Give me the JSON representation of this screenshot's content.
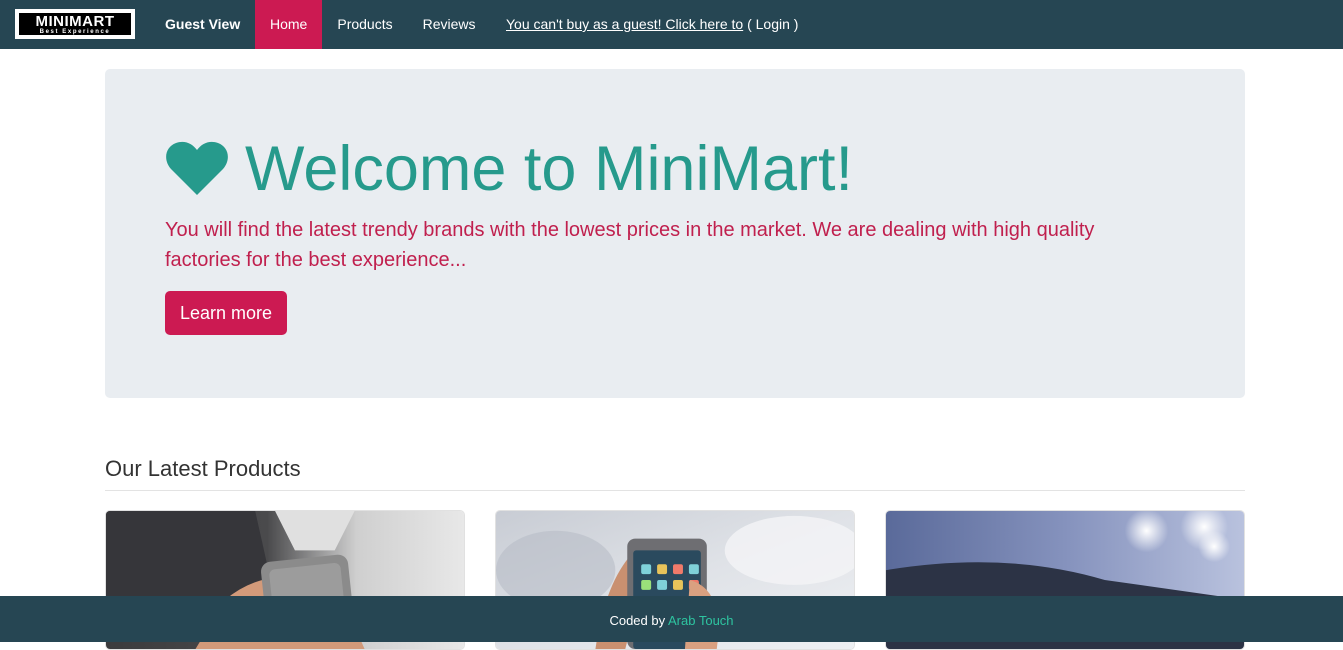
{
  "navbar": {
    "brand": {
      "main": "MINIMART",
      "sub": "Best Experience"
    },
    "guest_label": "Guest View",
    "links": [
      {
        "label": "Home",
        "active": true
      },
      {
        "label": "Products",
        "active": false
      },
      {
        "label": "Reviews",
        "active": false
      }
    ],
    "login_note": {
      "underlined": "You can't buy as a guest! Click here to",
      "rest": " ( Login )"
    },
    "bg_color": "#264653",
    "active_color": "#cc1a52"
  },
  "hero": {
    "icon": "heart-icon",
    "title": "Welcome to MiniMart!",
    "text": "You will find the latest trendy brands with the lowest prices in the market. We are dealing with high quality factories for the best experience...",
    "button_label": "Learn more",
    "title_color": "#269a8c",
    "text_color": "#c0204e"
  },
  "latest": {
    "heading": "Our Latest Products",
    "cards": [
      {
        "image": "person-holding-phone-photo"
      },
      {
        "image": "hand-holding-smartphone-photo"
      },
      {
        "image": "blurred-blue-lights-photo"
      }
    ]
  },
  "footer": {
    "prefix": "Coded by ",
    "author": "Arab Touch",
    "author_color": "#2ec4a0"
  }
}
